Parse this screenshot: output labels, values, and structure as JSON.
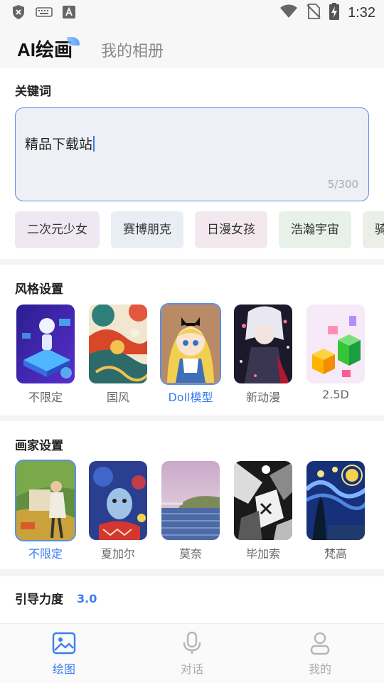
{
  "status_bar": {
    "time": "1:32",
    "icons": [
      "shield-x-icon",
      "keyboard-icon",
      "font-a-icon",
      "wifi-icon",
      "no-sim-icon",
      "battery-charging-icon"
    ]
  },
  "header": {
    "tab_active": "AI绘画",
    "tab_inactive": "我的相册"
  },
  "keywords": {
    "title": "关键词",
    "input_value": "精品下载站",
    "char_count": "5/300",
    "chips": [
      {
        "label": "二次元少女",
        "bg": "#efe8f3"
      },
      {
        "label": "赛博朋克",
        "bg": "#e9edf4"
      },
      {
        "label": "日漫女孩",
        "bg": "#f3e8ee"
      },
      {
        "label": "浩瀚宇宙",
        "bg": "#e7f1ea"
      },
      {
        "label": "骑",
        "bg": "#ebefe8"
      }
    ]
  },
  "style_settings": {
    "title": "风格设置",
    "items": [
      {
        "label": "不限定",
        "selected": false,
        "art": "tech"
      },
      {
        "label": "国风",
        "selected": false,
        "art": "guofeng"
      },
      {
        "label": "Doll模型",
        "selected": true,
        "art": "doll"
      },
      {
        "label": "新动漫",
        "selected": false,
        "art": "anime"
      },
      {
        "label": "2.5D",
        "selected": false,
        "art": "iso"
      }
    ]
  },
  "artist_settings": {
    "title": "画家设置",
    "items": [
      {
        "label": "不限定",
        "selected": true,
        "art": "cezanne"
      },
      {
        "label": "夏加尔",
        "selected": false,
        "art": "chagall"
      },
      {
        "label": "莫奈",
        "selected": false,
        "art": "monet"
      },
      {
        "label": "毕加索",
        "selected": false,
        "art": "picasso"
      },
      {
        "label": "梵高",
        "selected": false,
        "art": "vangogh"
      }
    ]
  },
  "guidance": {
    "title": "引导力度",
    "value": "3.0"
  },
  "bottom_nav": {
    "items": [
      {
        "label": "绘图",
        "icon": "image-icon",
        "active": true
      },
      {
        "label": "对话",
        "icon": "microphone-icon",
        "active": false
      },
      {
        "label": "我的",
        "icon": "user-icon",
        "active": false
      }
    ]
  },
  "colors": {
    "accent": "#3b7df0",
    "input_border": "#5b8ee8",
    "input_bg": "#eef0f5"
  }
}
